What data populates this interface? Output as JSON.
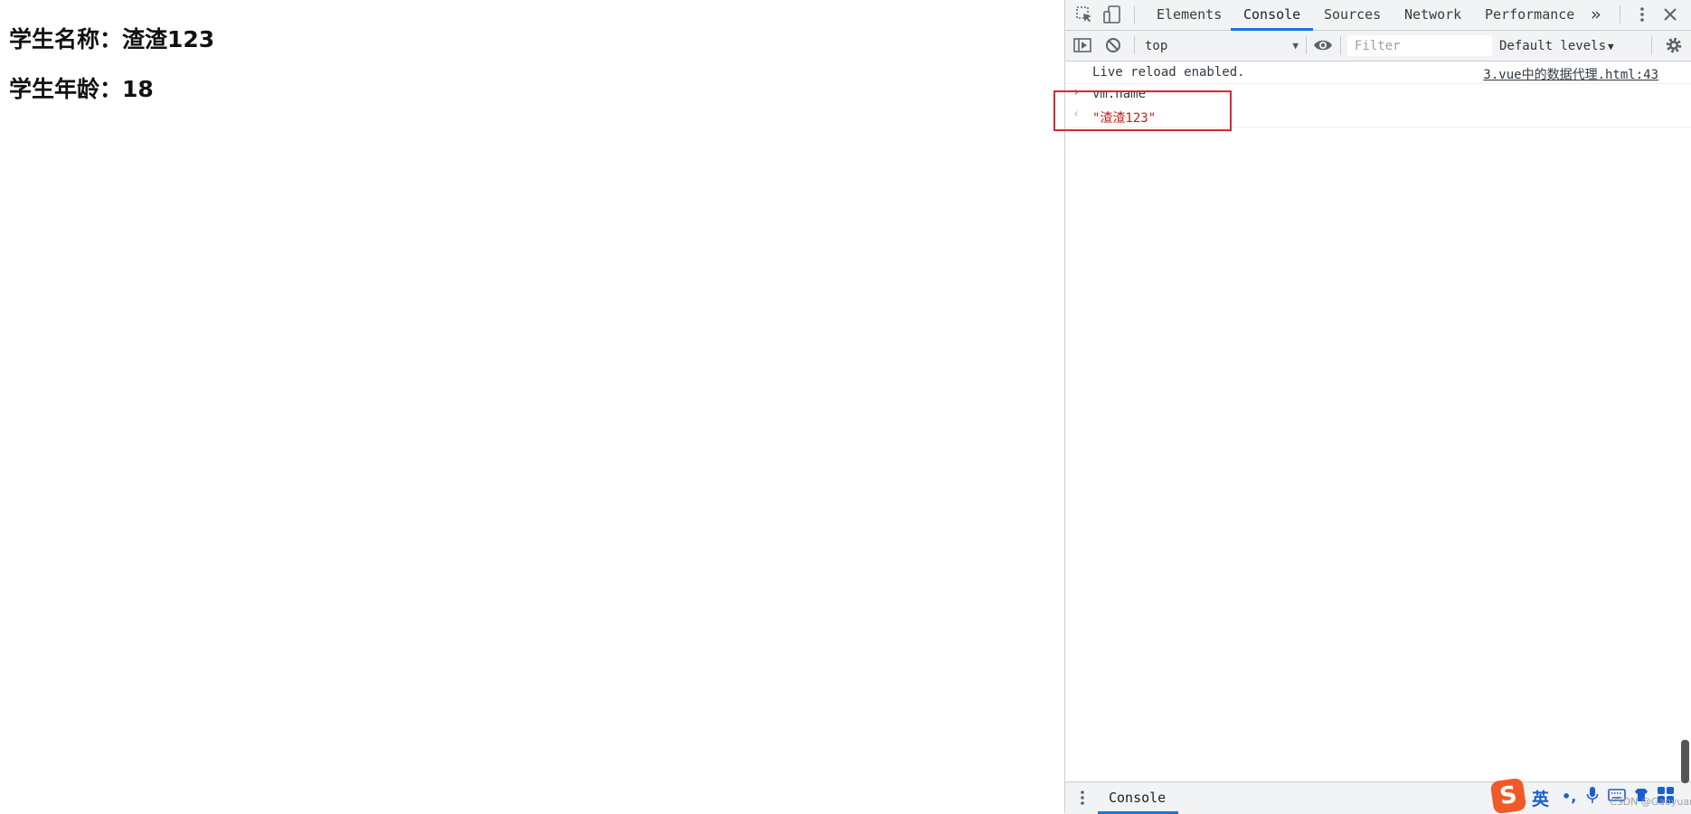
{
  "page": {
    "student_name_line": "学生名称：渣渣123",
    "student_age_line": "学生年龄：18"
  },
  "devtools": {
    "tabs": [
      {
        "label": "Elements",
        "active": false
      },
      {
        "label": "Console",
        "active": true
      },
      {
        "label": "Sources",
        "active": false
      },
      {
        "label": "Network",
        "active": false
      },
      {
        "label": "Performance",
        "active": false
      }
    ],
    "more_tabs_glyph": "»",
    "icons": {
      "inspect": "inspect-element-icon",
      "device": "device-toolbar-icon",
      "menu": "kebab-menu-icon",
      "close": "close-icon",
      "sidebar": "console-sidebar-icon",
      "clear": "clear-console-icon",
      "eye": "live-expression-eye-icon",
      "settings": "settings-gear-icon"
    },
    "toolbar": {
      "context": "top",
      "filter_placeholder": "Filter",
      "levels": "Default levels"
    },
    "console": {
      "log_message": "Live reload enabled.",
      "log_source": "3.vue中的数据代理.html:43",
      "command_glyph": "›",
      "command": "vm.name",
      "result_glyph": "‹",
      "result": "\"渣渣123\""
    },
    "drawer": {
      "tab": "Console"
    }
  },
  "ime": {
    "logo": "S",
    "language": "英",
    "watermark": "CSDN @Gaoyuan"
  },
  "colors": {
    "accent_blue": "#1a73e8",
    "highlight_red": "#d7282f",
    "result_red": "#c41a16",
    "ime_orange": "#f05a28"
  }
}
